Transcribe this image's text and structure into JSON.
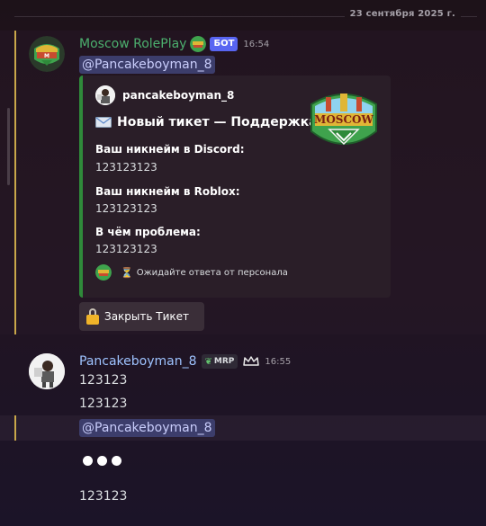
{
  "date_divider": "23 сентября 2025 г.",
  "bot_message": {
    "author": "Moscow RolePlay",
    "bot_tag": "БОТ",
    "time": "16:54",
    "mention": "@Pancakeboyman_8",
    "embed": {
      "accent_color": "#2f8a3a",
      "author_name": "pancakeboyman_8",
      "title_icon": "envelope-icon",
      "title": "Новый тикет — Поддержка",
      "fields": [
        {
          "name": "Ваш никнейм в Discord:",
          "value": "123123123"
        },
        {
          "name": "Ваш никнейм в Roblox:",
          "value": "123123123"
        },
        {
          "name": "В чём проблема:",
          "value": "123123123"
        }
      ],
      "thumbnail_label": "MOSCOW",
      "footer_icon": "hourglass-icon",
      "footer_text": "Ожидайте ответа от персонала"
    },
    "button_label": "Закрыть Тикет"
  },
  "user_message": {
    "author": "Pancakeboyman_8",
    "role_badge": "MRP",
    "time": "16:55",
    "lines": [
      "123123",
      "123123"
    ],
    "mention": "@Pancakeboyman_8",
    "typing": "●●●",
    "last_line": "123123"
  },
  "colors": {
    "bot_name": "#4caf6e",
    "user_name": "#9ec3ff",
    "bot_tag": "#5865f2",
    "mention_bg": "#3c3d6b",
    "mention_bar": "#c9a74a"
  }
}
